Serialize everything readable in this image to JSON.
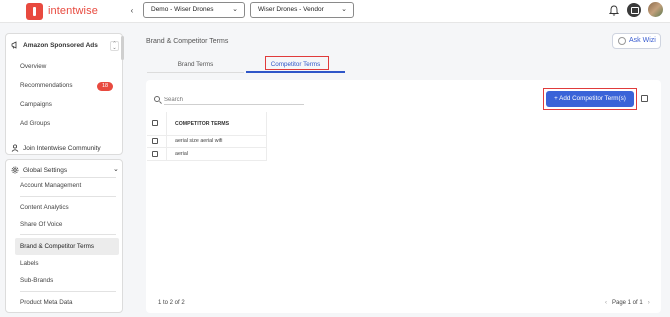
{
  "app": {
    "brand": "intentwise"
  },
  "header": {
    "account_select": "Demo - Wiser Drones",
    "profile_select": "Wiser Drones - Vendor"
  },
  "sidebar": {
    "section_title": "Amazon Sponsored Ads",
    "items": [
      {
        "label": "Overview"
      },
      {
        "label": "Recommendations",
        "badge": "18"
      },
      {
        "label": "Campaigns"
      },
      {
        "label": "Ad Groups"
      }
    ],
    "community": "Join Intentwise Community",
    "global_settings": "Global Settings",
    "settings_items": [
      {
        "label": "Account Management"
      },
      {
        "label": "Content Analytics"
      },
      {
        "label": "Share Of Voice"
      },
      {
        "label": "Brand & Competitor Terms"
      },
      {
        "label": "Labels"
      },
      {
        "label": "Sub-Brands"
      },
      {
        "label": "Product Meta Data"
      }
    ]
  },
  "main": {
    "title": "Brand & Competitor Terms",
    "ask_wizi": "Ask Wizi",
    "tabs": [
      {
        "label": "Brand Terms"
      },
      {
        "label": "Competitor Terms",
        "active": true
      }
    ],
    "search_placeholder": "Search",
    "add_button": "+ Add Competitor Term(s)",
    "table": {
      "header": "COMPETITOR TERMS",
      "rows": [
        "aerial size aerial wifi",
        "aerial"
      ]
    },
    "count": "1 to 2 of 2",
    "pagination": "Page 1 of 1"
  },
  "colors": {
    "accent": "#3a63d8",
    "brand": "#e84a3f",
    "highlight": "#e03b3b"
  }
}
